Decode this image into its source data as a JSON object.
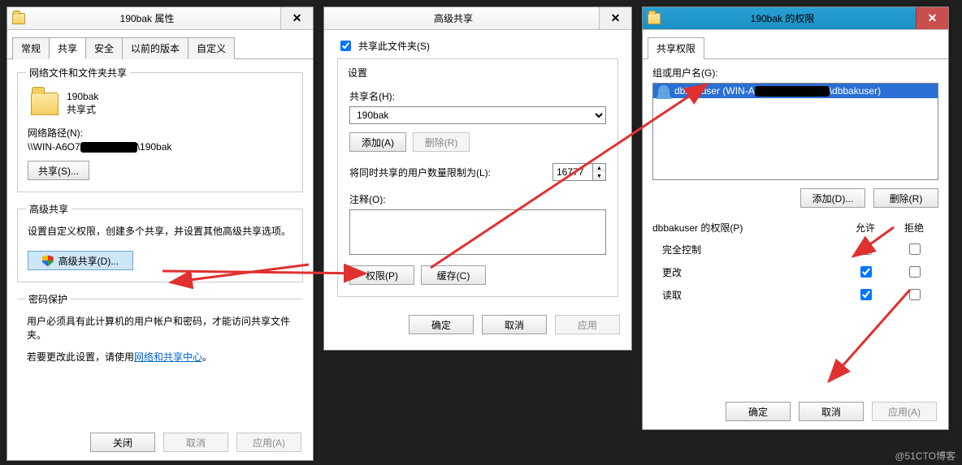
{
  "watermark": "@51CTO博客",
  "win1": {
    "title": "190bak 属性",
    "tabs": [
      "常规",
      "共享",
      "安全",
      "以前的版本",
      "自定义"
    ],
    "active_tab_idx": 1,
    "g1": {
      "legend": "网络文件和文件夹共享",
      "folder_name": "190bak",
      "share_mode": "共享式",
      "net_path_label": "网络路径(N):",
      "net_path_prefix": "\\\\WIN-A6O7",
      "net_path_suffix": "\\190bak",
      "share_btn": "共享(S)..."
    },
    "g2": {
      "legend": "高级共享",
      "desc": "设置自定义权限，创建多个共享，并设置其他高级共享选项。",
      "adv_btn": "高级共享(D)..."
    },
    "g3": {
      "legend": "密码保护",
      "line1": "用户必须具有此计算机的用户帐户和密码，才能访问共享文件夹。",
      "line2_a": "若要更改此设置，请使用",
      "link": "网络和共享中心",
      "line2_b": "。"
    },
    "btns": {
      "close": "关闭",
      "cancel": "取消",
      "apply": "应用(A)"
    }
  },
  "win2": {
    "title": "高级共享",
    "share_chk": "共享此文件夹(S)",
    "settings": "设置",
    "share_name_lbl": "共享名(H):",
    "share_name_val": "190bak",
    "add_btn": "添加(A)",
    "del_btn": "删除(R)",
    "limit_lbl": "将同时共享的用户数量限制为(L):",
    "limit_val": "16777",
    "comment_lbl": "注释(O):",
    "perm_btn": "权限(P)",
    "cache_btn": "缓存(C)",
    "ok": "确定",
    "cancel": "取消",
    "apply": "应用"
  },
  "win3": {
    "title": "190bak 的权限",
    "tab": "共享权限",
    "group_lbl": "组或用户名(G):",
    "user_prefix": "dbbakuser (WIN-A",
    "user_suffix": "\\dbbakuser)",
    "add_btn": "添加(D)...",
    "del_btn": "删除(R)",
    "perm_hdr": "dbbakuser 的权限(P)",
    "col_allow": "允许",
    "col_deny": "拒绝",
    "rows": [
      {
        "label": "完全控制",
        "allow": false,
        "deny": false
      },
      {
        "label": "更改",
        "allow": true,
        "deny": false
      },
      {
        "label": "读取",
        "allow": true,
        "deny": false
      }
    ],
    "ok": "确定",
    "cancel": "取消",
    "apply": "应用(A)"
  }
}
